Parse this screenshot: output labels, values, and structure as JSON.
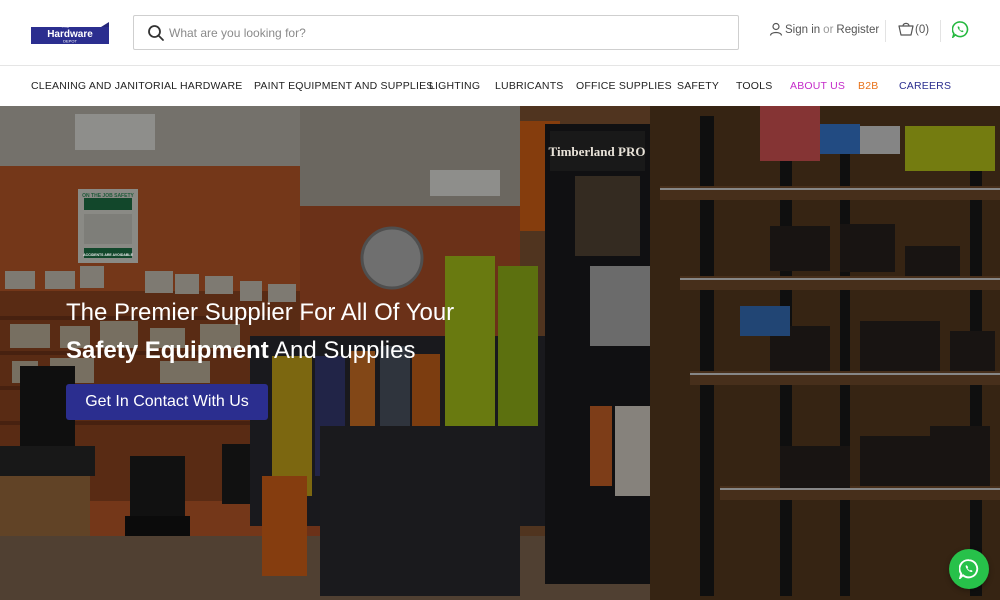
{
  "header": {
    "logo_top_text": "THE",
    "logo_main_text": "Hardware",
    "logo_sub_text": "DEPOT",
    "search_placeholder": "What are you looking for?",
    "sign_in": "Sign in",
    "or": "or",
    "register": "Register",
    "cart_count": "(0)",
    "icons": [
      "search-icon",
      "user-icon",
      "cart-icon",
      "whatsapp-icon"
    ]
  },
  "nav": {
    "items": [
      {
        "label": "CLEANING AND JANITORIAL",
        "color": "#222222"
      },
      {
        "label": "HARDWARE",
        "color": "#222222"
      },
      {
        "label": "PAINT EQUIPMENT AND SUPPLIES",
        "color": "#222222"
      },
      {
        "label": "LIGHTING",
        "color": "#222222"
      },
      {
        "label": "LUBRICANTS",
        "color": "#222222"
      },
      {
        "label": "OFFICE SUPPLIES",
        "color": "#222222"
      },
      {
        "label": "SAFETY",
        "color": "#222222"
      },
      {
        "label": "TOOLS",
        "color": "#222222"
      },
      {
        "label": "ABOUT US",
        "color": "#c42bc9"
      },
      {
        "label": "B2B",
        "color": "#e8731b"
      },
      {
        "label": "CAREERS",
        "color": "#2b2e8f"
      }
    ]
  },
  "hero": {
    "title_line1": "The Premier Supplier For All Of Your",
    "title_line2_bold": "Safety Equipment",
    "title_line2_rest": " And Supplies",
    "cta_label": "Get In Contact With Us",
    "sign_headline": "ON THE JOB SAFETY",
    "sign_footer": "ACCIDENTS ARE AVOIDABLE",
    "display_brand": "Timberland PRO",
    "button_color": "#2b2e8f"
  },
  "chat": {
    "icon": "whatsapp-icon",
    "color": "#27c14a"
  }
}
